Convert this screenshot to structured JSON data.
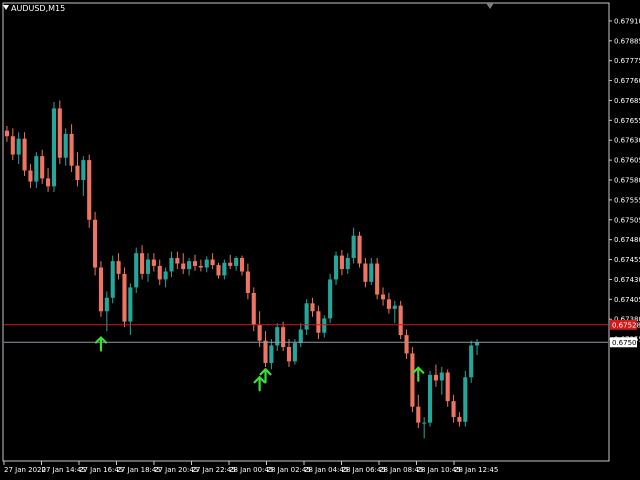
{
  "chart": {
    "symbol": "AUDUSD",
    "timeframe": "M15",
    "title": "AUDUSD,M15",
    "colors": {
      "background": "#000000",
      "frame": "#c8c8c8",
      "bull": "#26a69a",
      "bear": "#ef7462",
      "signal_arrow": "#3ddc3d",
      "ask_line": "#d11a1a",
      "bid_line": "#8c9aa8",
      "text": "#ffffff"
    },
    "icons": [
      "menu-triangle-icon",
      "up-arrow-icon",
      "chart-shift-marker-icon"
    ]
  },
  "chart_data": {
    "type": "candlestick",
    "y_range": [
      0.67358,
      0.6793
    ],
    "price_ticks": [
      "0.67910",
      "0.67885",
      "0.67775",
      "0.67760",
      "0.67685",
      "0.67655",
      "0.67630",
      "0.67605",
      "0.67580",
      "0.67555",
      "0.67505",
      "0.67480",
      "0.67455",
      "0.67430",
      "0.67405",
      "0.67380",
      "0.67355"
    ],
    "price_tick_values": [
      0.6791,
      0.67885,
      0.6786,
      0.67835,
      0.6781,
      0.67785,
      0.6776,
      0.67735,
      0.6771,
      0.67685,
      0.6766,
      0.67635,
      0.6761,
      0.67585,
      0.6756,
      0.67535,
      0.6751
    ],
    "time_ticks": [
      "27 Jan 2020",
      "27 Jan 14:45",
      "27 Jan 16:45",
      "27 Jan 18:45",
      "27 Jan 20:45",
      "27 Jan 22:45",
      "28 Jan 00:45",
      "28 Jan 02:45",
      "28 Jan 04:45",
      "28 Jan 06:45",
      "28 Jan 08:45",
      "28 Jan 10:45",
      "28 Jan 12:45"
    ],
    "ask_label": "0.67528",
    "bid_label": "0.67506",
    "ask_price": 0.67528,
    "bid_price": 0.67506,
    "candles": [
      [
        0.67772,
        0.67778,
        0.67758,
        0.67765
      ],
      [
        0.67765,
        0.67775,
        0.67735,
        0.67742
      ],
      [
        0.67742,
        0.6777,
        0.6773,
        0.67762
      ],
      [
        0.67762,
        0.6777,
        0.67715,
        0.67722
      ],
      [
        0.67722,
        0.6773,
        0.677,
        0.67708
      ],
      [
        0.67708,
        0.67745,
        0.677,
        0.6774
      ],
      [
        0.6774,
        0.67748,
        0.67705,
        0.67712
      ],
      [
        0.67712,
        0.67725,
        0.67695,
        0.67702
      ],
      [
        0.67702,
        0.67808,
        0.67695,
        0.678
      ],
      [
        0.678,
        0.6781,
        0.6773,
        0.67738
      ],
      [
        0.67738,
        0.67775,
        0.67728,
        0.67768
      ],
      [
        0.67768,
        0.6778,
        0.6772,
        0.67728
      ],
      [
        0.67728,
        0.67745,
        0.67702,
        0.6771
      ],
      [
        0.6771,
        0.6774,
        0.6769,
        0.67735
      ],
      [
        0.67735,
        0.67742,
        0.6765,
        0.6766
      ],
      [
        0.6766,
        0.6767,
        0.6759,
        0.676
      ],
      [
        0.676,
        0.67608,
        0.67538,
        0.67545
      ],
      [
        0.67545,
        0.6757,
        0.6752,
        0.67562
      ],
      [
        0.67562,
        0.67615,
        0.67555,
        0.67608
      ],
      [
        0.67608,
        0.67618,
        0.67585,
        0.67592
      ],
      [
        0.67592,
        0.676,
        0.67525,
        0.67532
      ],
      [
        0.67532,
        0.6758,
        0.67515,
        0.67575
      ],
      [
        0.67575,
        0.67625,
        0.67568,
        0.67618
      ],
      [
        0.67618,
        0.67628,
        0.67585,
        0.67592
      ],
      [
        0.67592,
        0.67618,
        0.67582,
        0.6761
      ],
      [
        0.6761,
        0.67618,
        0.67595,
        0.67602
      ],
      [
        0.67602,
        0.6761,
        0.67578,
        0.67585
      ],
      [
        0.67585,
        0.676,
        0.67575,
        0.67595
      ],
      [
        0.67595,
        0.6762,
        0.67588,
        0.67612
      ],
      [
        0.67612,
        0.6762,
        0.67598,
        0.67605
      ],
      [
        0.67605,
        0.67618,
        0.67592,
        0.67598
      ],
      [
        0.67598,
        0.67612,
        0.6759,
        0.67608
      ],
      [
        0.67608,
        0.67616,
        0.67596,
        0.67602
      ],
      [
        0.67602,
        0.6761,
        0.67595,
        0.676
      ],
      [
        0.676,
        0.67614,
        0.67594,
        0.6761
      ],
      [
        0.6761,
        0.67618,
        0.67598,
        0.67603
      ],
      [
        0.67603,
        0.67606,
        0.67586,
        0.6759
      ],
      [
        0.6759,
        0.6761,
        0.67585,
        0.67606
      ],
      [
        0.67606,
        0.67616,
        0.67598,
        0.67602
      ],
      [
        0.67602,
        0.67614,
        0.67596,
        0.67612
      ],
      [
        0.67612,
        0.67615,
        0.6759,
        0.67595
      ],
      [
        0.67595,
        0.67605,
        0.6756,
        0.67568
      ],
      [
        0.67568,
        0.67575,
        0.6752,
        0.67528
      ],
      [
        0.67528,
        0.67545,
        0.675,
        0.67508
      ],
      [
        0.67508,
        0.6752,
        0.67475,
        0.6748
      ],
      [
        0.6748,
        0.6751,
        0.67472,
        0.67502
      ],
      [
        0.67502,
        0.6753,
        0.67495,
        0.67525
      ],
      [
        0.67525,
        0.67532,
        0.67495,
        0.675
      ],
      [
        0.675,
        0.6751,
        0.67475,
        0.67482
      ],
      [
        0.67482,
        0.6751,
        0.67478,
        0.67505
      ],
      [
        0.67505,
        0.6753,
        0.675,
        0.67522
      ],
      [
        0.67522,
        0.6756,
        0.67515,
        0.67555
      ],
      [
        0.67555,
        0.67562,
        0.67538,
        0.67545
      ],
      [
        0.67545,
        0.67552,
        0.6751,
        0.67518
      ],
      [
        0.67518,
        0.6754,
        0.67512,
        0.67536
      ],
      [
        0.67536,
        0.67592,
        0.6753,
        0.67585
      ],
      [
        0.67585,
        0.6762,
        0.67578,
        0.67615
      ],
      [
        0.67615,
        0.67622,
        0.6759,
        0.67598
      ],
      [
        0.67598,
        0.67618,
        0.67592,
        0.67612
      ],
      [
        0.67612,
        0.6765,
        0.67605,
        0.6764
      ],
      [
        0.6764,
        0.67645,
        0.676,
        0.67605
      ],
      [
        0.67605,
        0.67612,
        0.67575,
        0.67582
      ],
      [
        0.67582,
        0.67612,
        0.67578,
        0.67605
      ],
      [
        0.67605,
        0.67612,
        0.6756,
        0.67566
      ],
      [
        0.67566,
        0.67575,
        0.67552,
        0.6756
      ],
      [
        0.6756,
        0.67568,
        0.67542,
        0.67548
      ],
      [
        0.67548,
        0.67558,
        0.6753,
        0.67552
      ],
      [
        0.67552,
        0.67558,
        0.6751,
        0.67515
      ],
      [
        0.67515,
        0.67522,
        0.67485,
        0.67492
      ],
      [
        0.67492,
        0.675,
        0.67418,
        0.67425
      ],
      [
        0.67425,
        0.6744,
        0.67398,
        0.67405
      ],
      [
        0.67405,
        0.67412,
        0.67385,
        0.67405
      ],
      [
        0.67405,
        0.6747,
        0.674,
        0.67465
      ],
      [
        0.67465,
        0.67478,
        0.6745,
        0.67458
      ],
      [
        0.67458,
        0.67475,
        0.6744,
        0.67468
      ],
      [
        0.67468,
        0.67472,
        0.67425,
        0.67432
      ],
      [
        0.67432,
        0.6744,
        0.67405,
        0.67412
      ],
      [
        0.67412,
        0.67418,
        0.674,
        0.67406
      ],
      [
        0.67406,
        0.6747,
        0.674,
        0.67462
      ],
      [
        0.67462,
        0.67508,
        0.67455,
        0.67502
      ],
      [
        0.67502,
        0.6751,
        0.6749,
        0.67506
      ]
    ],
    "signals": [
      {
        "candle": 16,
        "price": 0.67512
      },
      {
        "candle": 43,
        "price": 0.67462
      },
      {
        "candle": 44,
        "price": 0.67472
      },
      {
        "candle": 70,
        "price": 0.67474
      }
    ]
  }
}
